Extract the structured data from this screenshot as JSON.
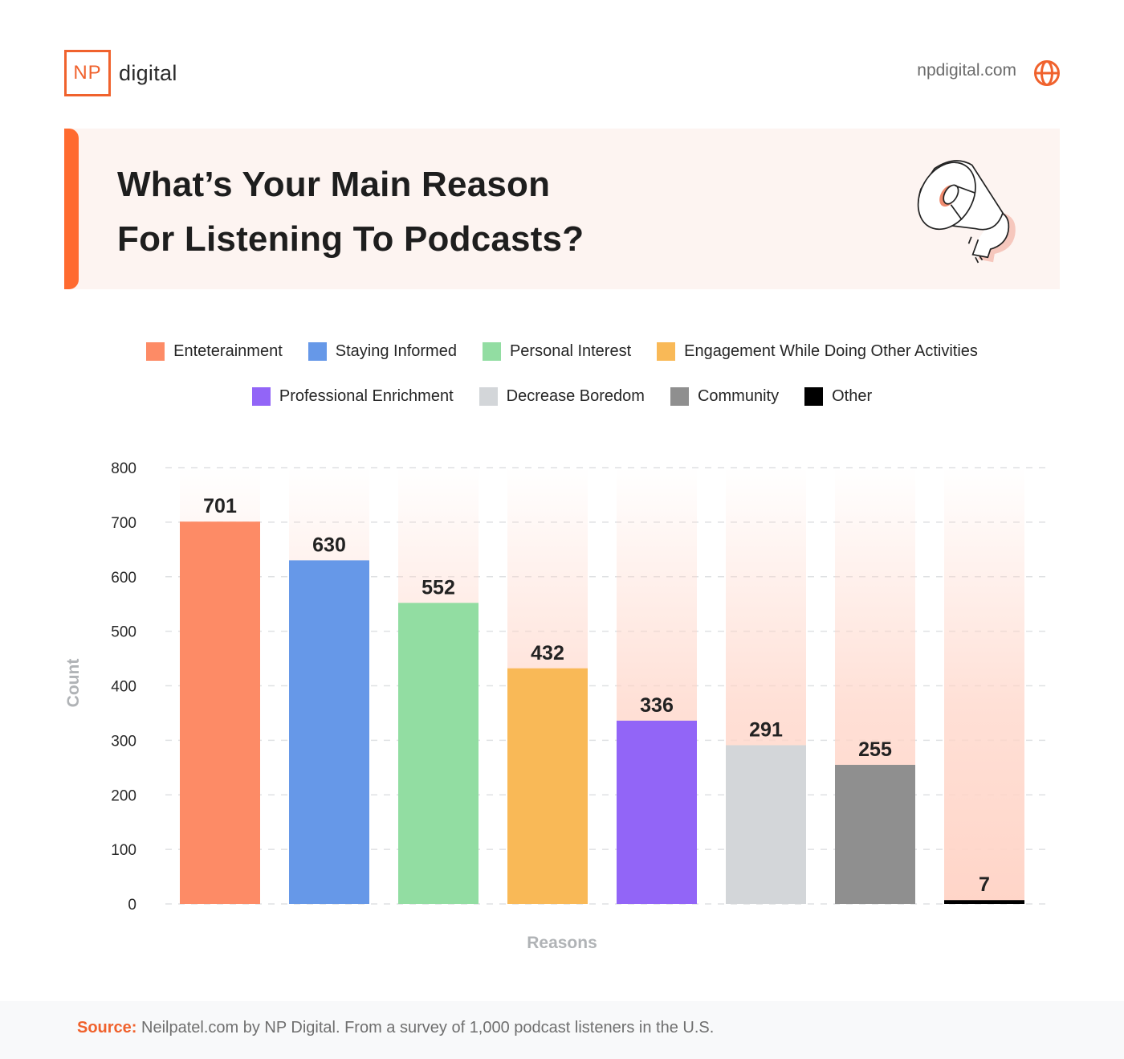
{
  "header": {
    "logo_mark": "NP",
    "logo_text": "digital",
    "site_url": "npdigital.com",
    "site_icon": "globe-icon",
    "brand_color": "#f0622d"
  },
  "banner": {
    "title_line1": "What’s Your Main Reason",
    "title_line2": "For Listening To Podcasts?",
    "illustration": "megaphone-icon"
  },
  "footer": {
    "source_label": "Source:",
    "source_text": " Neilpatel.com by NP Digital. From a survey of 1,000 podcast listeners in the U.S."
  },
  "chart_data": {
    "type": "bar",
    "title": "What’s Your Main Reason For Listening To Podcasts?",
    "xlabel": "Reasons",
    "ylabel": "Count",
    "ylim": [
      0,
      800
    ],
    "yticks": [
      0,
      100,
      200,
      300,
      400,
      500,
      600,
      700,
      800
    ],
    "grid": true,
    "legend_position": "top-center",
    "categories": [
      "Enteterainment",
      "Staying Informed",
      "Personal Interest",
      "Engagement While Doing Other Activities",
      "Professional Enrichment",
      "Decrease Boredom",
      "Community",
      "Other"
    ],
    "values": [
      701,
      630,
      552,
      432,
      336,
      291,
      255,
      7
    ],
    "colors": [
      "#fd8b66",
      "#6698e8",
      "#92dda2",
      "#f9b957",
      "#9265f7",
      "#d3d6d9",
      "#8f8f8f",
      "#000000"
    ],
    "background_bar_color": "#ffd5c8"
  }
}
